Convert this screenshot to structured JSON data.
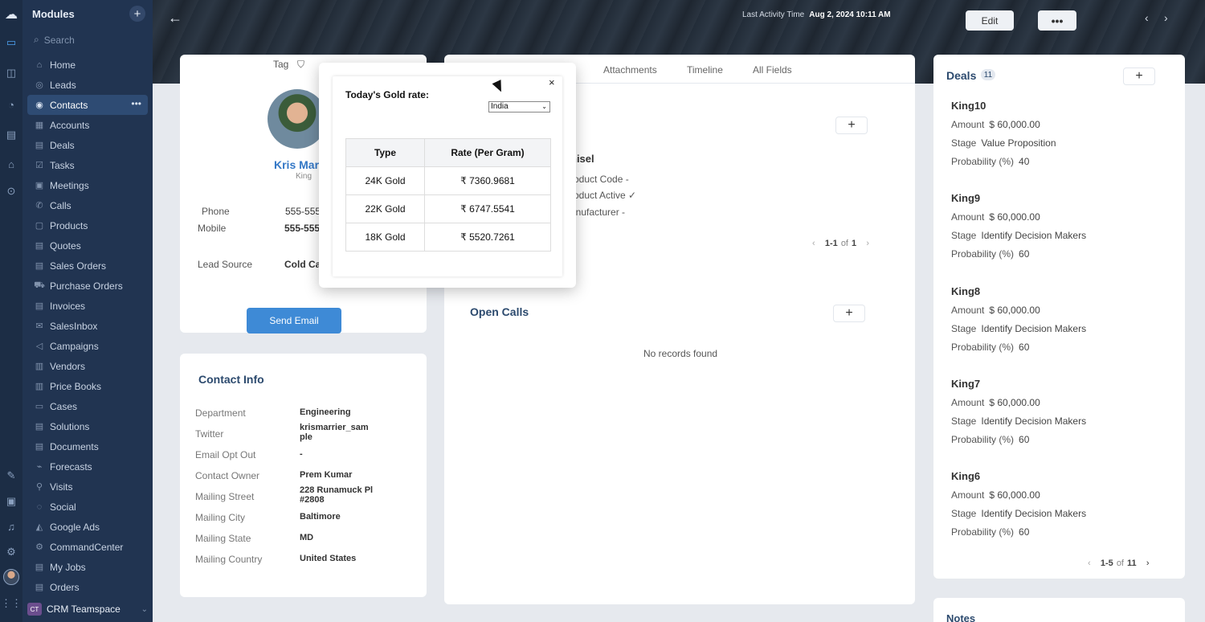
{
  "sidebar": {
    "title": "Modules",
    "search_placeholder": "Search",
    "items": [
      {
        "label": "Home",
        "icon": "home-icon"
      },
      {
        "label": "Leads",
        "icon": "leads-icon"
      },
      {
        "label": "Contacts",
        "icon": "contacts-icon",
        "active": true
      },
      {
        "label": "Accounts",
        "icon": "accounts-icon"
      },
      {
        "label": "Deals",
        "icon": "deals-icon"
      },
      {
        "label": "Tasks",
        "icon": "tasks-icon"
      },
      {
        "label": "Meetings",
        "icon": "meetings-icon"
      },
      {
        "label": "Calls",
        "icon": "calls-icon"
      },
      {
        "label": "Products",
        "icon": "products-icon"
      },
      {
        "label": "Quotes",
        "icon": "quotes-icon"
      },
      {
        "label": "Sales Orders",
        "icon": "sales-orders-icon"
      },
      {
        "label": "Purchase Orders",
        "icon": "purchase-orders-icon"
      },
      {
        "label": "Invoices",
        "icon": "invoices-icon"
      },
      {
        "label": "SalesInbox",
        "icon": "salesinbox-icon"
      },
      {
        "label": "Campaigns",
        "icon": "campaigns-icon"
      },
      {
        "label": "Vendors",
        "icon": "vendors-icon"
      },
      {
        "label": "Price Books",
        "icon": "price-books-icon"
      },
      {
        "label": "Cases",
        "icon": "cases-icon"
      },
      {
        "label": "Solutions",
        "icon": "solutions-icon"
      },
      {
        "label": "Documents",
        "icon": "documents-icon"
      },
      {
        "label": "Forecasts",
        "icon": "forecasts-icon"
      },
      {
        "label": "Visits",
        "icon": "visits-icon"
      },
      {
        "label": "Social",
        "icon": "social-icon"
      },
      {
        "label": "Google Ads",
        "icon": "google-ads-icon"
      },
      {
        "label": "CommandCenter",
        "icon": "commandcenter-icon"
      },
      {
        "label": "My Jobs",
        "icon": "my-jobs-icon"
      },
      {
        "label": "Orders",
        "icon": "orders-icon"
      }
    ],
    "team": {
      "badge": "CT",
      "label": "CRM Teamspace"
    }
  },
  "header": {
    "last_activity_label": "Last Activity Time",
    "last_activity_value": "Aug 2, 2024 10:11 AM",
    "edit_label": "Edit",
    "more_label": "•••"
  },
  "profile": {
    "tag_label": "Tag",
    "name": "Kris Mar",
    "title": "King",
    "fields": [
      {
        "label": "Phone",
        "value": "555-555"
      },
      {
        "label": "Mobile",
        "value": "555-555"
      },
      {
        "label": "Lead Source",
        "value": "Cold Ca"
      }
    ],
    "send_email_label": "Send Email"
  },
  "contact_info": {
    "heading": "Contact Info",
    "rows": [
      {
        "label": "Department",
        "value": "Engineering"
      },
      {
        "label": "Twitter",
        "value": "krismarrier_sam ple"
      },
      {
        "label": "Email Opt Out",
        "value": "-"
      },
      {
        "label": "Contact Owner",
        "value": "Prem Kumar"
      },
      {
        "label": "Mailing Street",
        "value": "228 Runamuck Pl #2808"
      },
      {
        "label": "Mailing City",
        "value": "Baltimore"
      },
      {
        "label": "Mailing State",
        "value": "MD"
      },
      {
        "label": "Mailing Country",
        "value": "United States"
      }
    ]
  },
  "middle": {
    "tabs": [
      "Attachments",
      "Timeline",
      "All Fields"
    ],
    "product_name": "hisel",
    "product_fields": [
      "roduct Code  -",
      "roduct Active  ✓",
      "anufacturer  -"
    ],
    "pager": {
      "range": "1-1",
      "of": "of",
      "total": "1"
    },
    "open_calls_heading": "Open Calls",
    "no_records": "No records found"
  },
  "deals": {
    "heading": "Deals",
    "count": "11",
    "items": [
      {
        "name": "King10",
        "amount": "$ 60,000.00",
        "stage": "Value Proposition",
        "probability": "40"
      },
      {
        "name": "King9",
        "amount": "$ 60,000.00",
        "stage": "Identify Decision Makers",
        "probability": "60"
      },
      {
        "name": "King8",
        "amount": "$ 60,000.00",
        "stage": "Identify Decision Makers",
        "probability": "60"
      },
      {
        "name": "King7",
        "amount": "$ 60,000.00",
        "stage": "Identify Decision Makers",
        "probability": "60"
      },
      {
        "name": "King6",
        "amount": "$ 60,000.00",
        "stage": "Identify Decision Makers",
        "probability": "60"
      }
    ],
    "field_labels": {
      "amount": "Amount",
      "stage": "Stage",
      "probability": "Probability (%)"
    },
    "pager": {
      "range": "1-5",
      "of": "of",
      "total": "11"
    }
  },
  "notes": {
    "heading": "Notes"
  },
  "gold_widget": {
    "title": "Today's Gold rate:",
    "country": "India",
    "columns": [
      "Type",
      "Rate (Per Gram)"
    ],
    "rows": [
      [
        "24K Gold",
        "₹ 7360.9681"
      ],
      [
        "22K Gold",
        "₹ 6747.5541"
      ],
      [
        "18K Gold",
        "₹ 5520.7261"
      ]
    ],
    "close_label": "×"
  }
}
